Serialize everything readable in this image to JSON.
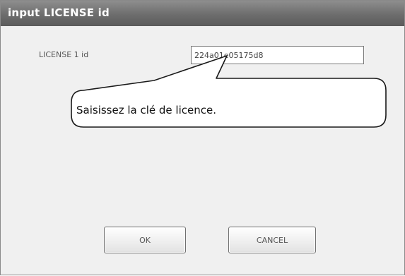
{
  "window": {
    "title": "input LICENSE  id"
  },
  "form": {
    "license_label": "LICENSE 1 id",
    "license_value": "224a01e05175d8"
  },
  "callout": {
    "text": "Saisissez la clé de licence."
  },
  "buttons": {
    "ok_label": "OK",
    "cancel_label": "CANCEL"
  }
}
